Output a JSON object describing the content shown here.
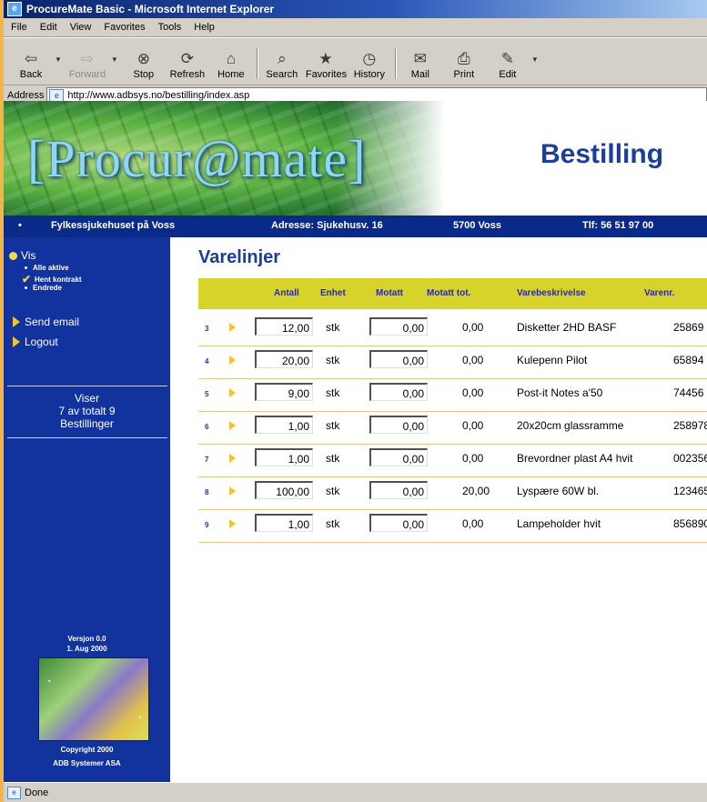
{
  "window": {
    "title": "ProcureMate Basic - Microsoft Internet Explorer"
  },
  "menu": [
    "File",
    "Edit",
    "View",
    "Favorites",
    "Tools",
    "Help"
  ],
  "toolbar": [
    {
      "label": "Back",
      "icon": "back-arrow-icon",
      "glyph": "⇦"
    },
    {
      "label": "Forward",
      "icon": "forward-arrow-icon",
      "glyph": "⇨"
    },
    {
      "label": "Stop",
      "icon": "stop-icon",
      "glyph": "⊗"
    },
    {
      "label": "Refresh",
      "icon": "refresh-icon",
      "glyph": "⟳"
    },
    {
      "label": "Home",
      "icon": "home-icon",
      "glyph": "⌂"
    },
    {
      "label": "Search",
      "icon": "search-icon",
      "glyph": "⌕"
    },
    {
      "label": "Favorites",
      "icon": "favorites-icon",
      "glyph": "★"
    },
    {
      "label": "History",
      "icon": "history-icon",
      "glyph": "◷"
    },
    {
      "label": "Mail",
      "icon": "mail-icon",
      "glyph": "✉"
    },
    {
      "label": "Print",
      "icon": "print-icon",
      "glyph": "⎙"
    },
    {
      "label": "Edit",
      "icon": "edit-icon",
      "glyph": "✎"
    }
  ],
  "address": {
    "label": "Address",
    "url": "http://www.adbsys.no/bestilling/index.asp"
  },
  "banner": {
    "logo_text": "[Procur@mate]",
    "title": "Bestilling"
  },
  "info": {
    "org": "Fylkessjukehuset på Voss",
    "address": "Adresse: Sjukehusv. 16",
    "postal": "5700 Voss",
    "phone": "Tlf: 56 51 97 00"
  },
  "sidebar": {
    "vis": "Vis",
    "vis_options": [
      "Alle aktive",
      "Hent kontrakt",
      "Endrede"
    ],
    "send_email": "Send email",
    "logout": "Logout",
    "viser_line1": "Viser",
    "viser_line2": "7 av totalt  9",
    "viser_line3": "Bestillinger",
    "version_line1": "Versjon 0.0",
    "version_line2": "1. Aug 2000",
    "copyright_line1": "Copyright 2000",
    "copyright_line2": "ADB Systemer ASA"
  },
  "page": {
    "heading": "Varelinjer"
  },
  "table": {
    "headers": {
      "antall": "Antall",
      "enhet": "Enhet",
      "motatt": "Motatt",
      "motatt_tot": "Motatt tot.",
      "beskrivelse": "Varebeskrivelse",
      "varenr": "Varenr."
    },
    "rows": [
      {
        "num": "3",
        "antall": "12,00",
        "enhet": "stk",
        "motatt": "0,00",
        "motatt_tot": "0,00",
        "beskrivelse": "Disketter 2HD BASF",
        "varenr": "25869"
      },
      {
        "num": "4",
        "antall": "20,00",
        "enhet": "stk",
        "motatt": "0,00",
        "motatt_tot": "0,00",
        "beskrivelse": "Kulepenn Pilot",
        "varenr": "65894"
      },
      {
        "num": "5",
        "antall": "9,00",
        "enhet": "stk",
        "motatt": "0,00",
        "motatt_tot": "0,00",
        "beskrivelse": "Post-it Notes a'50",
        "varenr": "74456"
      },
      {
        "num": "6",
        "antall": "1,00",
        "enhet": "stk",
        "motatt": "0,00",
        "motatt_tot": "0,00",
        "beskrivelse": "20x20cm glassramme",
        "varenr": "258978"
      },
      {
        "num": "7",
        "antall": "1,00",
        "enhet": "stk",
        "motatt": "0,00",
        "motatt_tot": "0,00",
        "beskrivelse": "Brevordner plast A4 hvit",
        "varenr": "002356"
      },
      {
        "num": "8",
        "antall": "100,00",
        "enhet": "stk",
        "motatt": "0,00",
        "motatt_tot": "20,00",
        "beskrivelse": "Lyspære 60W bl.",
        "varenr": "123465"
      },
      {
        "num": "9",
        "antall": "1,00",
        "enhet": "stk",
        "motatt": "0,00",
        "motatt_tot": "0,00",
        "beskrivelse": "Lampeholder hvit",
        "varenr": "856890"
      }
    ]
  },
  "status": {
    "text": "Done"
  }
}
